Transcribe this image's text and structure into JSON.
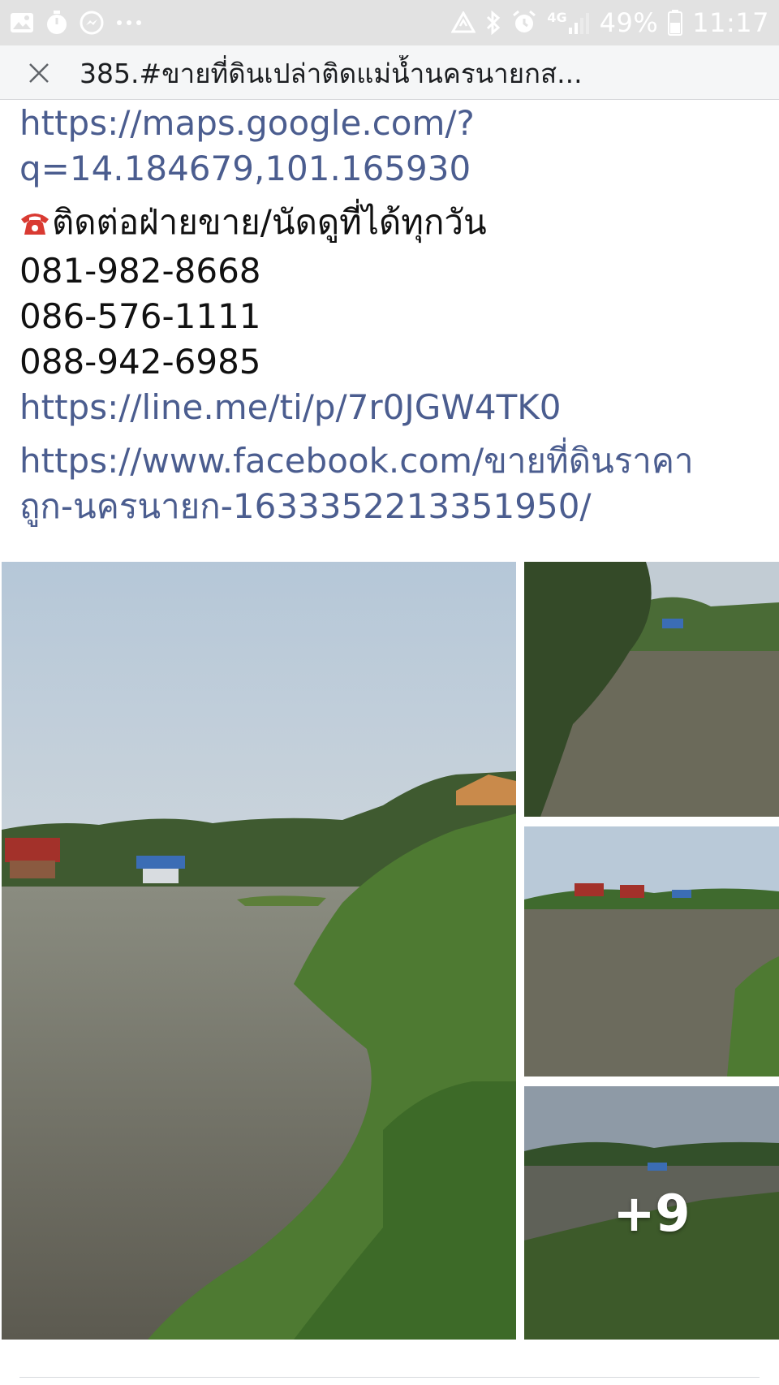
{
  "status_bar": {
    "battery": "49%",
    "time": "11:17",
    "network": "4G",
    "left_icons": [
      "gallery-icon",
      "timer-icon",
      "messenger-icon",
      "more-dots-icon"
    ],
    "right_icons": [
      "recycle-icon",
      "bluetooth-icon",
      "alarm-icon",
      "signal-icon",
      "battery-icon"
    ]
  },
  "header": {
    "title": "385.#ขายที่ดินเปล่าติดแม่น้ำนครนายกส..."
  },
  "post": {
    "maps_link_line1": "https://maps.google.com/?",
    "maps_link_line2": "q=14.184679,101.165930",
    "contact_heading": "ติดต่อฝ่ายขาย/นัดดูที่ได้ทุกวัน",
    "phones": [
      "081-982-8668",
      "086-576-1111",
      "088-942-6985"
    ],
    "line_link": "https://line.me/ti/p/7r0JGW4TK0",
    "facebook_link_line1": "https://www.facebook.com/ขายที่ดินราคา",
    "facebook_link_line2": "ถูก-นครนายก-1633352213351950/"
  },
  "photos": {
    "more_count": "+9"
  },
  "colors": {
    "link": "#4b5d8f",
    "status_bar_bg": "#e2e2e2",
    "title_bar_bg": "#f5f6f7"
  }
}
